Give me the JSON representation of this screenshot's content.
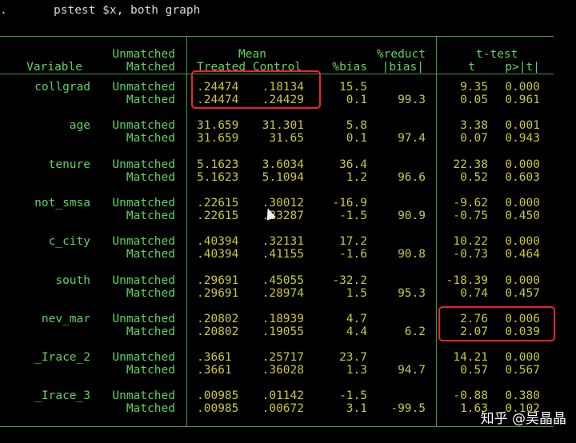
{
  "command": {
    "prompt": ".",
    "text": "pstest $x, both graph"
  },
  "header": {
    "variable": "Variable",
    "unmatched": "Unmatched",
    "matched": "Matched",
    "mean": "Mean",
    "treated_control": "Treated Control",
    "bias": "%bias",
    "reduct": "%reduct",
    "abs_bias": "|bias|",
    "ttest": "t-test",
    "t": "t",
    "p": "p>|t|"
  },
  "rows": [
    {
      "var": "collgrad",
      "u": {
        "label": "Unmatched",
        "treated": ".24474",
        "control": ".18134",
        "bias": "15.5",
        "reduct": "",
        "t": "9.35",
        "p": "0.000"
      },
      "m": {
        "label": "Matched",
        "treated": ".24474",
        "control": ".24429",
        "bias": "0.1",
        "reduct": "99.3",
        "t": "0.05",
        "p": "0.961"
      }
    },
    {
      "var": "age",
      "u": {
        "label": "Unmatched",
        "treated": "31.659",
        "control": "31.301",
        "bias": "5.8",
        "reduct": "",
        "t": "3.38",
        "p": "0.001"
      },
      "m": {
        "label": "Matched",
        "treated": "31.659",
        "control": "31.65",
        "bias": "0.1",
        "reduct": "97.4",
        "t": "0.07",
        "p": "0.943"
      }
    },
    {
      "var": "tenure",
      "u": {
        "label": "Unmatched",
        "treated": "5.1623",
        "control": "3.6034",
        "bias": "36.4",
        "reduct": "",
        "t": "22.38",
        "p": "0.000"
      },
      "m": {
        "label": "Matched",
        "treated": "5.1623",
        "control": "5.1094",
        "bias": "1.2",
        "reduct": "96.6",
        "t": "0.52",
        "p": "0.603"
      }
    },
    {
      "var": "not_smsa",
      "u": {
        "label": "Unmatched",
        "treated": ".22615",
        "control": ".30012",
        "bias": "-16.9",
        "reduct": "",
        "t": "-9.62",
        "p": "0.000"
      },
      "m": {
        "label": "Matched",
        "treated": ".22615",
        "control": ".23287",
        "bias": "-1.5",
        "reduct": "90.9",
        "t": "-0.75",
        "p": "0.450"
      }
    },
    {
      "var": "c_city",
      "u": {
        "label": "Unmatched",
        "treated": ".40394",
        "control": ".32131",
        "bias": "17.2",
        "reduct": "",
        "t": "10.22",
        "p": "0.000"
      },
      "m": {
        "label": "Matched",
        "treated": ".40394",
        "control": ".41155",
        "bias": "-1.6",
        "reduct": "90.8",
        "t": "-0.73",
        "p": "0.464"
      }
    },
    {
      "var": "south",
      "u": {
        "label": "Unmatched",
        "treated": ".29691",
        "control": ".45055",
        "bias": "-32.2",
        "reduct": "",
        "t": "-18.39",
        "p": "0.000"
      },
      "m": {
        "label": "Matched",
        "treated": ".29691",
        "control": ".28974",
        "bias": "1.5",
        "reduct": "95.3",
        "t": "0.74",
        "p": "0.457"
      }
    },
    {
      "var": "nev_mar",
      "u": {
        "label": "Unmatched",
        "treated": ".20802",
        "control": ".18939",
        "bias": "4.7",
        "reduct": "",
        "t": "2.76",
        "p": "0.006"
      },
      "m": {
        "label": "Matched",
        "treated": ".20802",
        "control": ".19055",
        "bias": "4.4",
        "reduct": "6.2",
        "t": "2.07",
        "p": "0.039"
      }
    },
    {
      "var": "_Irace_2",
      "u": {
        "label": "Unmatched",
        "treated": ".3661",
        "control": ".25717",
        "bias": "23.7",
        "reduct": "",
        "t": "14.21",
        "p": "0.000"
      },
      "m": {
        "label": "Matched",
        "treated": ".3661",
        "control": ".36028",
        "bias": "1.3",
        "reduct": "94.7",
        "t": "0.57",
        "p": "0.567"
      }
    },
    {
      "var": "_Irace_3",
      "u": {
        "label": "Unmatched",
        "treated": ".00985",
        "control": ".01142",
        "bias": "-1.5",
        "reduct": "",
        "t": "-0.88",
        "p": "0.380"
      },
      "m": {
        "label": "Matched",
        "treated": ".00985",
        "control": ".00672",
        "bias": "3.1",
        "reduct": "-99.5",
        "t": "1.63",
        "p": "0.102"
      }
    }
  ],
  "watermark": "知乎 @吴晶晶",
  "colors": {
    "background": "#000000",
    "label": "#5fd35f",
    "value": "#c8c83c",
    "highlight": "#e8262a"
  }
}
